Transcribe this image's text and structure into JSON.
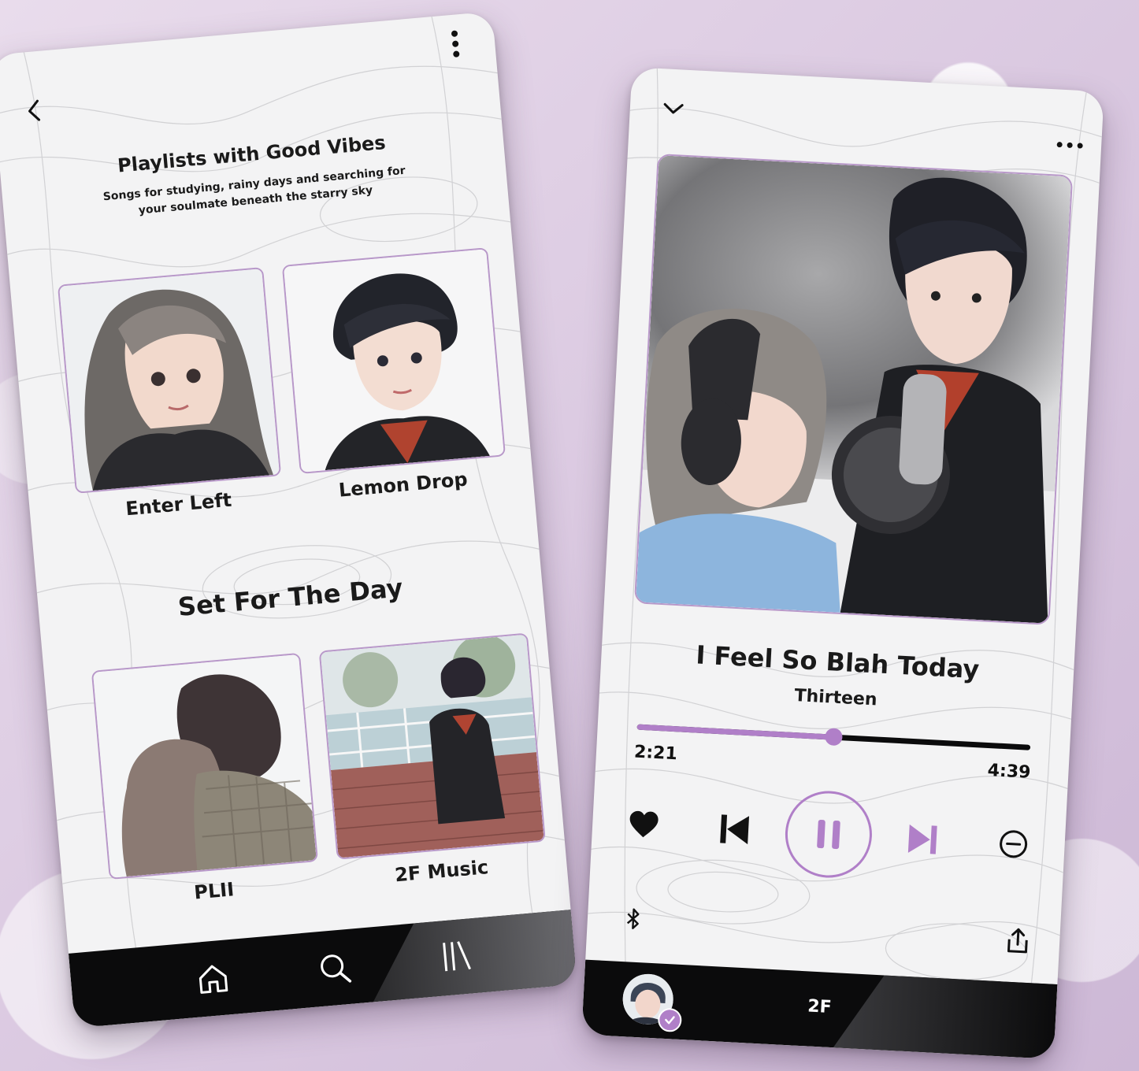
{
  "left_screen": {
    "back_icon": "chevron-left-icon",
    "menu_icon": "vertical-dots-icon",
    "header": {
      "title": "Playlists with Good Vibes",
      "subtitle": "Songs for studying, rainy days and searching for your soulmate beneath the starry sky"
    },
    "featured_playlists": [
      {
        "label": "Enter Left"
      },
      {
        "label": "Lemon Drop"
      }
    ],
    "section_title": "Set For The Day",
    "day_playlists": [
      {
        "label": "PLII"
      },
      {
        "label": "2F Music"
      }
    ],
    "nav": [
      {
        "icon": "home-icon"
      },
      {
        "icon": "search-icon"
      },
      {
        "icon": "library-icon"
      }
    ]
  },
  "right_screen": {
    "collapse_icon": "chevron-down-icon",
    "menu_icon": "horizontal-dots-icon",
    "track": {
      "title": "I Feel So Blah Today",
      "artist": "Thirteen",
      "elapsed": "2:21",
      "duration": "4:39",
      "progress": 0.5
    },
    "controls": {
      "like_icon": "heart-icon",
      "prev_icon": "skip-previous-icon",
      "pause_icon": "pause-icon",
      "next_icon": "skip-next-icon",
      "remove_icon": "minus-circle-icon",
      "bluetooth_icon": "bluetooth-icon",
      "share_icon": "share-icon"
    },
    "now_bar": {
      "label": "2F"
    }
  },
  "colors": {
    "accent": "#b07fc8",
    "dark": "#0b0b0c",
    "card_border": "#b898c9"
  }
}
